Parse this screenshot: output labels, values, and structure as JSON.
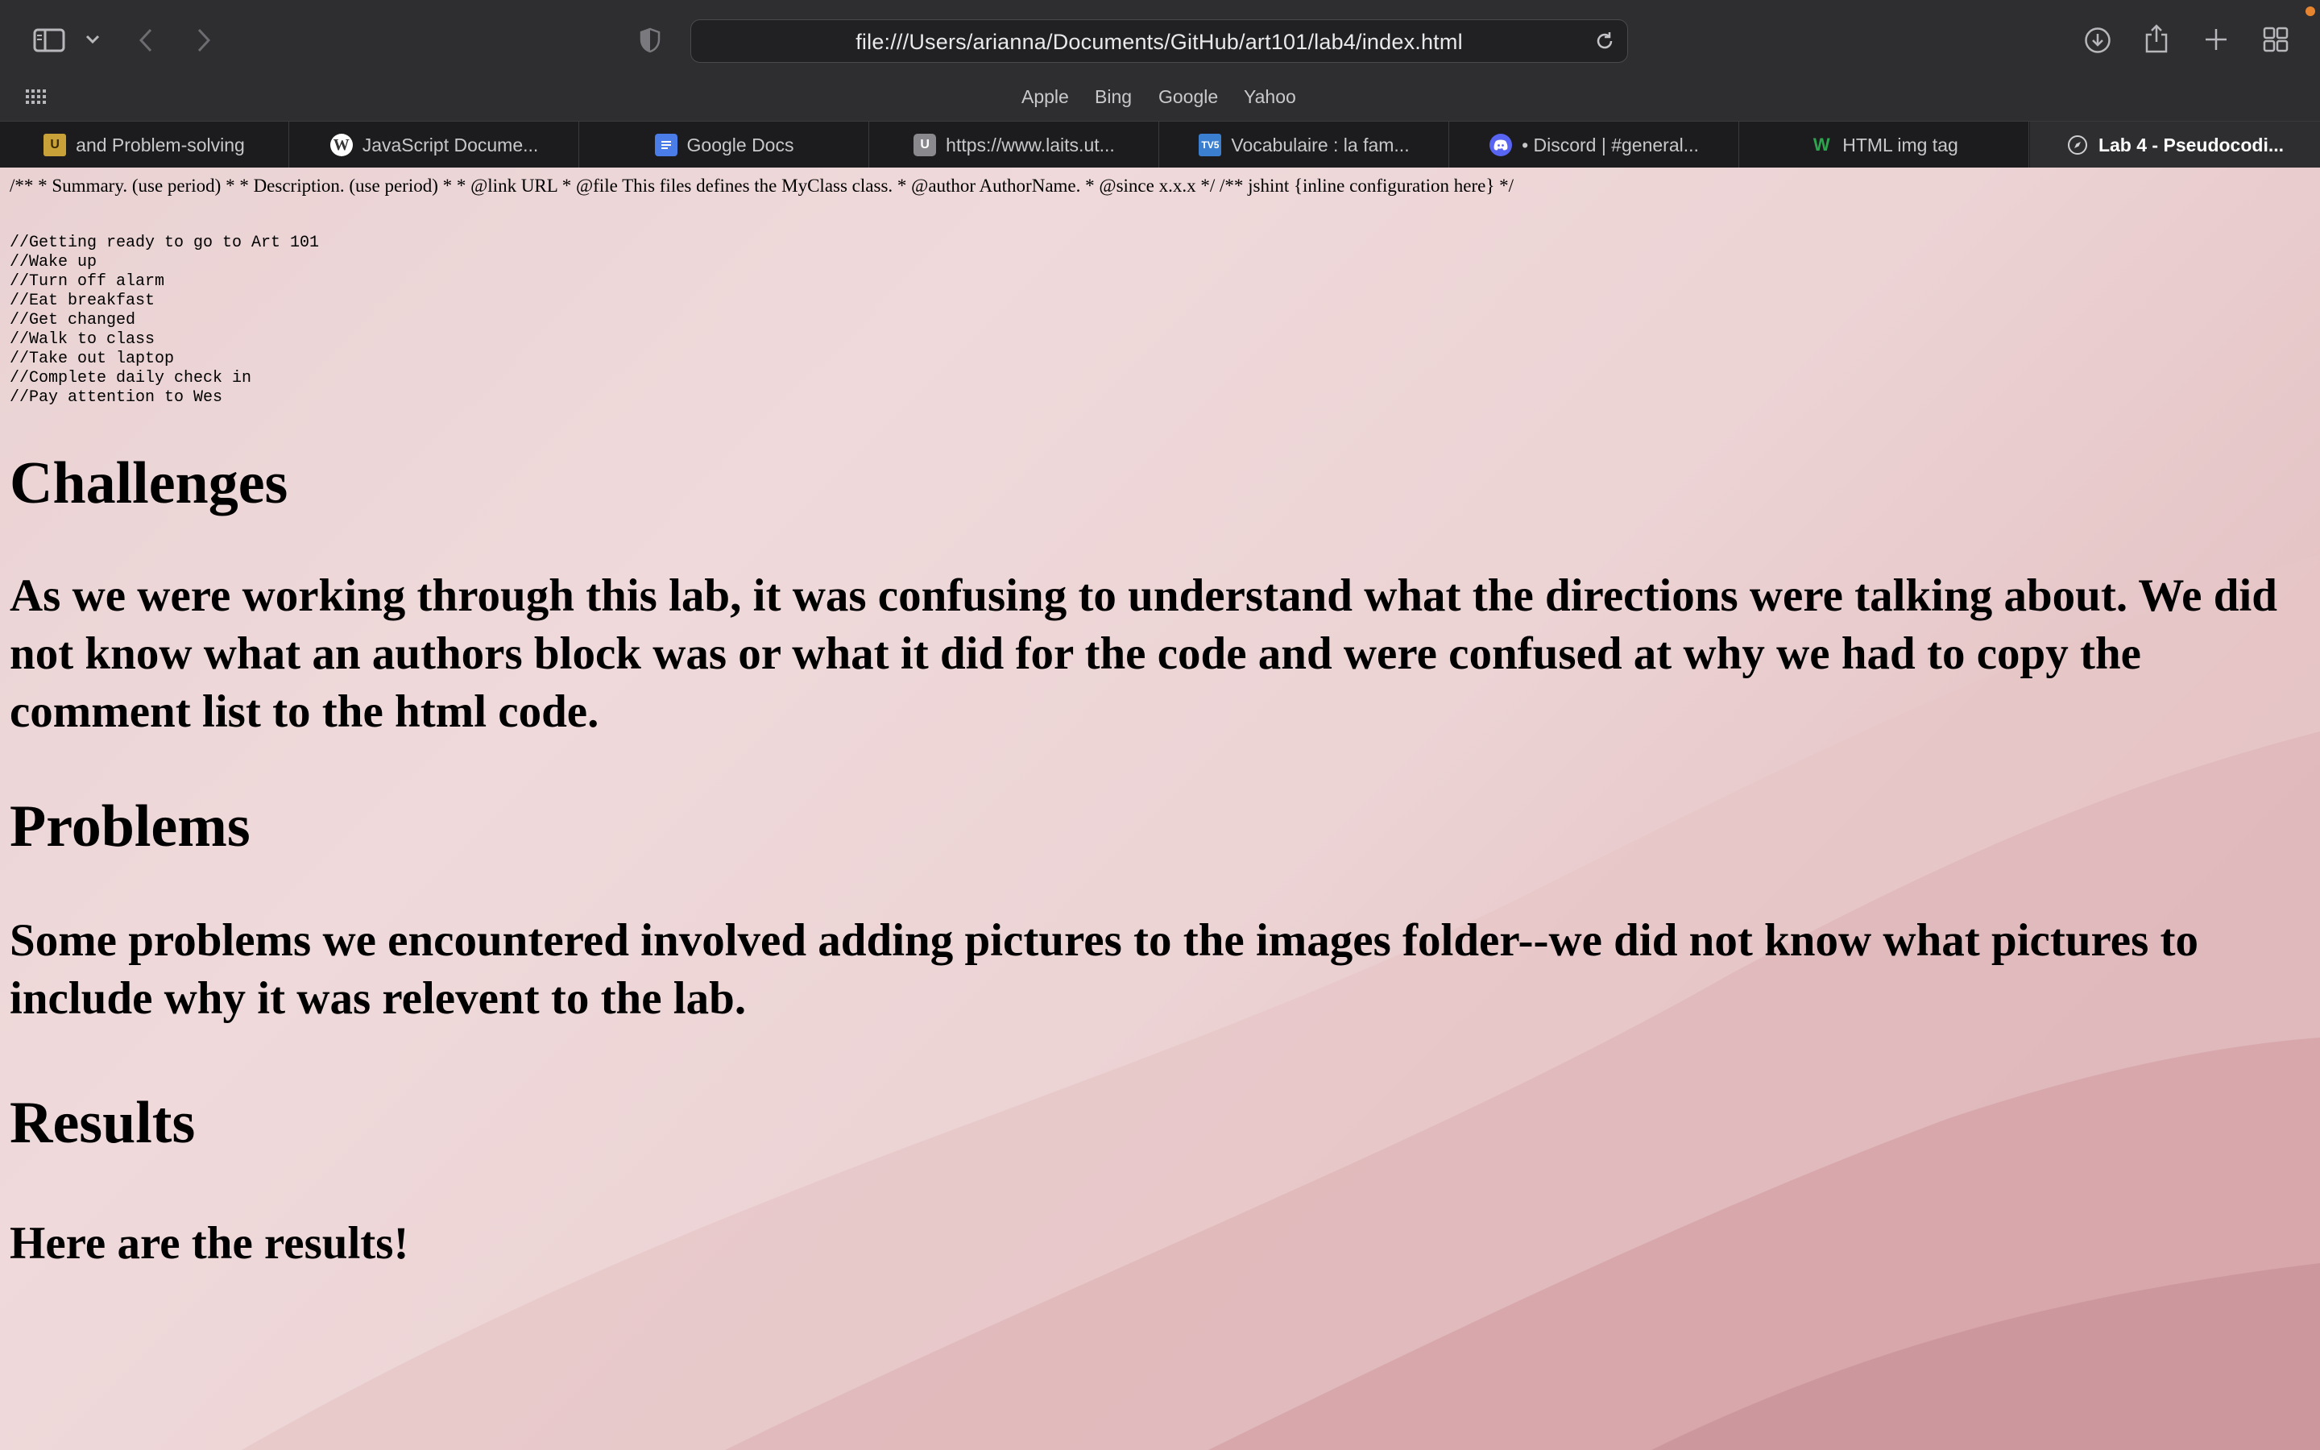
{
  "browser": {
    "url": "file:///Users/arianna/Documents/GitHub/art101/lab4/index.html",
    "favorites": [
      "Apple",
      "Bing",
      "Google",
      "Yahoo"
    ],
    "tabs": [
      {
        "label": "and Problem-solving",
        "icon": "ucsc-icon"
      },
      {
        "label": "JavaScript Docume...",
        "icon": "wordpress-icon"
      },
      {
        "label": "Google Docs",
        "icon": "google-docs-icon"
      },
      {
        "label": "https://www.laits.ut...",
        "icon": "letter-u-icon"
      },
      {
        "label": "Vocabulaire : la fam...",
        "icon": "tv5-icon"
      },
      {
        "label": "• Discord | #general...",
        "icon": "discord-icon"
      },
      {
        "label": "HTML img tag",
        "icon": "w3-icon"
      },
      {
        "label": "Lab 4 - Pseudocodi...",
        "icon": "compass-icon",
        "active": true
      }
    ]
  },
  "page": {
    "doc_comment": "/** * Summary. (use period) * * Description. (use period) * * @link URL * @file This files defines the MyClass class. * @author AuthorName. * @since x.x.x */ /** jshint {inline configuration here} */",
    "pseudocode": "//Getting ready to go to Art 101\n//Wake up\n//Turn off alarm\n//Eat breakfast\n//Get changed\n//Walk to class\n//Take out laptop\n//Complete daily check in\n//Pay attention to Wes",
    "challenges_heading": "Challenges",
    "challenges_text": "As we were working through this lab, it was confusing to understand what the directions were talking about. We did not know what an authors block was or what it did for the code and were confused at why we had to copy the comment list to the html code.",
    "problems_heading": "Problems",
    "problems_text": "Some problems we encountered involved adding pictures to the images folder--we did not know what pictures to include why it was relevent to the lab.",
    "results_heading": "Results",
    "results_text": "Here are the results!"
  },
  "colors": {
    "chrome_bg": "#2e2e30",
    "tabbar_bg": "#1c1c1e",
    "page_bg": "#ecd3d4",
    "notification_dot": "#e6842f"
  }
}
